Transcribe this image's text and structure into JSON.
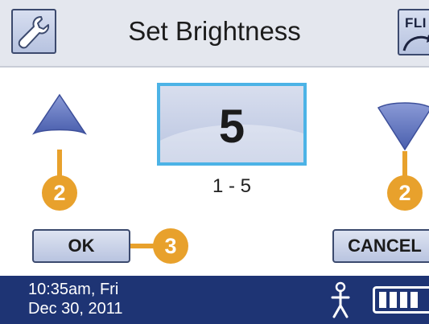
{
  "header": {
    "title": "Set Brightness",
    "settings_icon": "wrench-icon",
    "right_button_label": "FLI"
  },
  "setting": {
    "value": "5",
    "range": "1 - 5",
    "increase_icon": "up-arrow-icon",
    "decrease_icon": "down-arrow-icon"
  },
  "callouts": {
    "up_arrow": "2",
    "down_arrow": "2",
    "ok_button": "3"
  },
  "buttons": {
    "ok_label": "OK",
    "cancel_label": "CANCEL"
  },
  "status": {
    "time": "10:35am, Fri",
    "date": "Dec 30, 2011",
    "activity_icon": "person-icon",
    "battery_icon": "battery-icon"
  },
  "colors": {
    "header_bg": "#e4e7ee",
    "footer_bg": "#1e3474",
    "value_border": "#4cb3e6",
    "callout": "#e8a12c",
    "arrow": "#5a70c0"
  }
}
